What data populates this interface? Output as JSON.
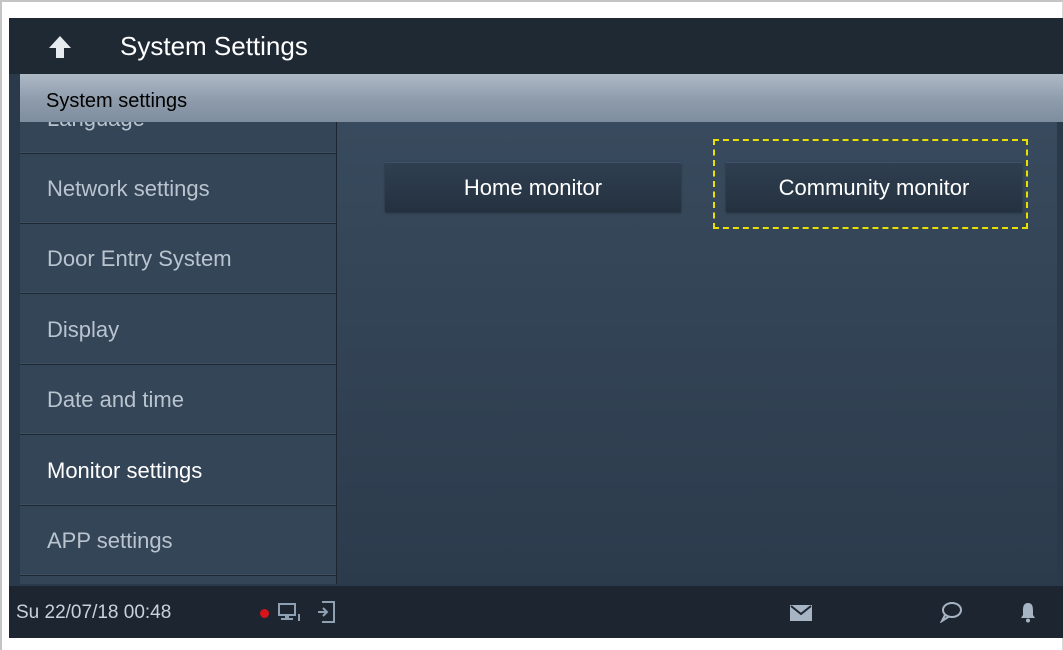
{
  "header": {
    "title": "System Settings",
    "back_icon": "back-arrow-icon"
  },
  "section": {
    "title": "System settings"
  },
  "sidebar": {
    "items": [
      {
        "label": "Language",
        "active": false
      },
      {
        "label": "Network settings",
        "active": false
      },
      {
        "label": "Door Entry System",
        "active": false
      },
      {
        "label": "Display",
        "active": false
      },
      {
        "label": "Date and time",
        "active": false
      },
      {
        "label": "Monitor settings",
        "active": true
      },
      {
        "label": "APP settings",
        "active": false
      }
    ]
  },
  "content": {
    "buttons": [
      {
        "label": "Home monitor"
      },
      {
        "label": "Community monitor",
        "focused": true
      }
    ]
  },
  "statusbar": {
    "datetime": "Su 22/07/18  00:48",
    "indicators": [
      "record-dot-icon",
      "monitor-1-icon",
      "door-exit-icon"
    ],
    "actions": [
      "mail-icon",
      "message-icon",
      "bell-icon"
    ]
  },
  "colors": {
    "background": "#2b3a4b",
    "topbar": "#1f2934",
    "section_bar": "#9aa7b6",
    "focus_outline": "#e8e000",
    "record_dot": "#d8141b",
    "text_active": "#ffffff",
    "text_inactive": "#b9c4cf"
  }
}
